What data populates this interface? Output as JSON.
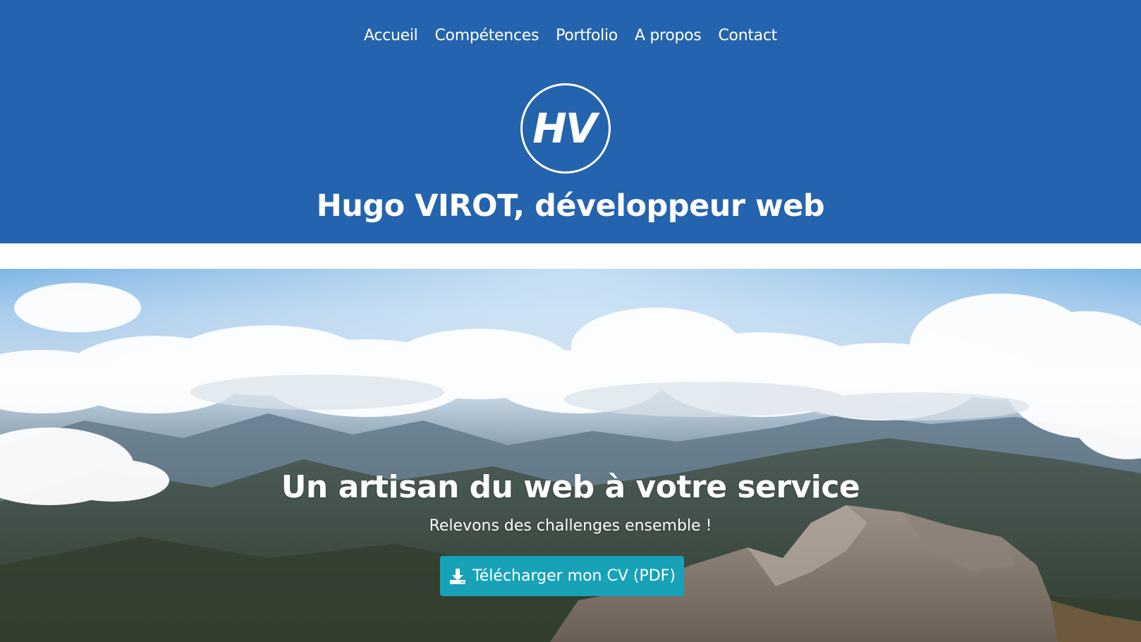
{
  "nav": {
    "items": [
      {
        "label": "Accueil",
        "name": "nav-accueil"
      },
      {
        "label": "Compétences",
        "name": "nav-competences"
      },
      {
        "label": "Portfolio",
        "name": "nav-portfolio"
      },
      {
        "label": "A propos",
        "name": "nav-a-propos"
      },
      {
        "label": "Contact",
        "name": "nav-contact"
      }
    ]
  },
  "header": {
    "logo_text": "HV",
    "title": "Hugo VIROT, développeur web"
  },
  "hero": {
    "title": "Un artisan du web à votre service",
    "subtitle": "Relevons des challenges ensemble !",
    "cv_button": {
      "label": "Télécharger mon CV (PDF)",
      "icon": "download-icon"
    }
  },
  "colors": {
    "header_bg": "#2463ae",
    "button_bg": "#17a2b8",
    "text": "#ffffff"
  }
}
